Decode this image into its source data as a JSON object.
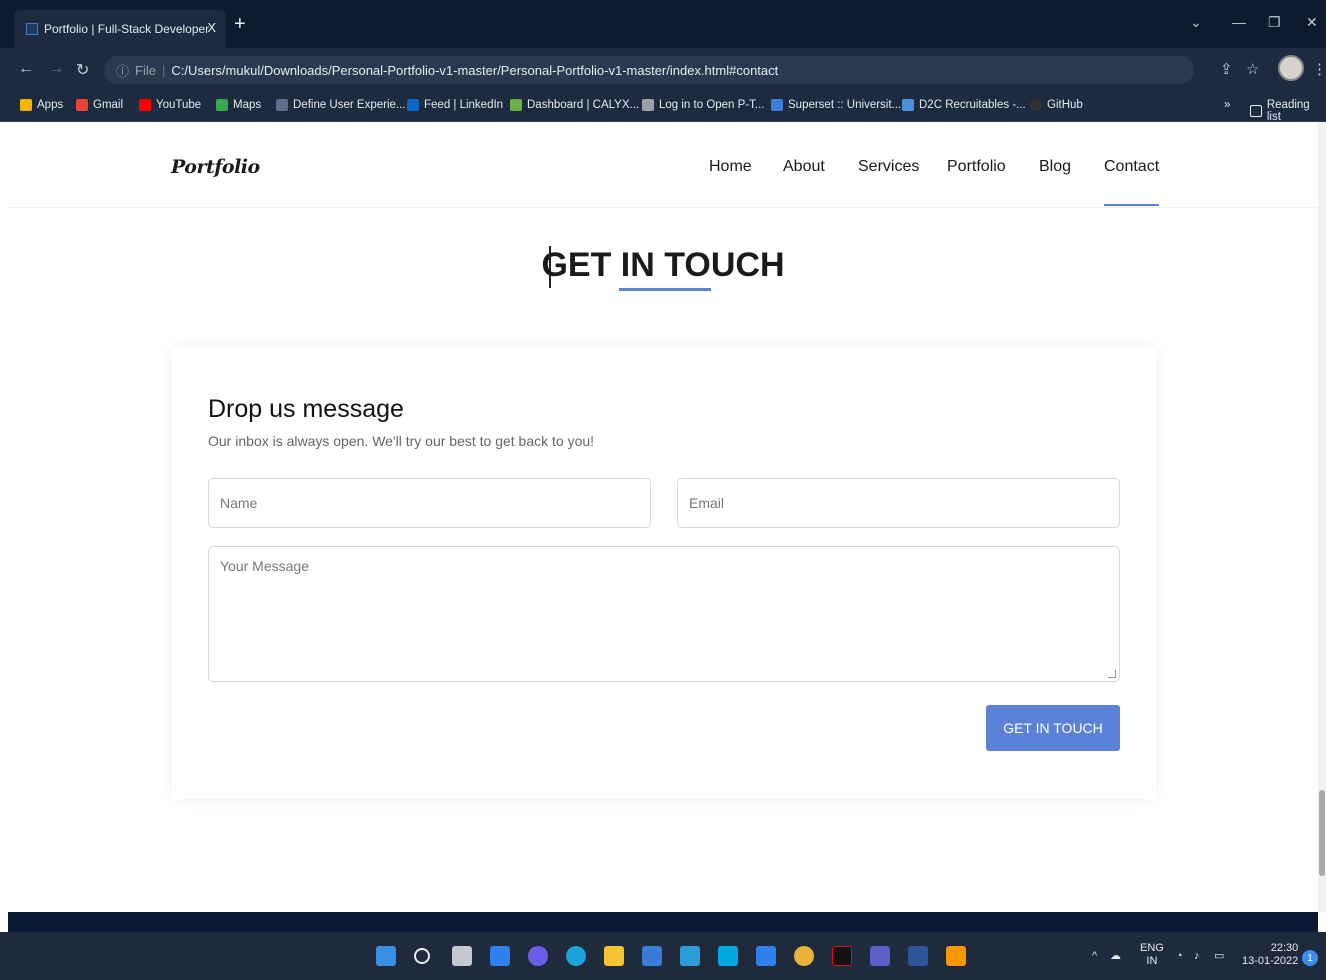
{
  "browser": {
    "tab_title": "Portfolio | Full-Stack Developer",
    "tab_close": "X",
    "new_tab": "+",
    "url_scheme": "File",
    "url": "C:/Users/mukul/Downloads/Personal-Portfolio-v1-master/Personal-Portfolio-v1-master/index.html#contact",
    "bookmarks": [
      {
        "label": "Apps",
        "color": "#f4b400"
      },
      {
        "label": "Gmail",
        "color": "#ea4335"
      },
      {
        "label": "YouTube",
        "color": "#ff0000"
      },
      {
        "label": "Maps",
        "color": "#34a853"
      },
      {
        "label": "Define User Experie...",
        "color": "#5b6f8c"
      },
      {
        "label": "Feed | LinkedIn",
        "color": "#0a66c2"
      },
      {
        "label": "Dashboard | CALYX...",
        "color": "#6ab04c"
      },
      {
        "label": "Log in to Open P-T...",
        "color": "#9aa0a6"
      },
      {
        "label": "Superset :: Universit...",
        "color": "#3c7fd8"
      },
      {
        "label": "D2C Recruitables -...",
        "color": "#4a90d9"
      },
      {
        "label": "GitHub",
        "color": "#333333"
      }
    ],
    "overflow": "»",
    "reading_list": "Reading list"
  },
  "site": {
    "logo": "Portfolio",
    "nav": [
      "Home",
      "About",
      "Services",
      "Portfolio",
      "Blog",
      "Contact"
    ],
    "active_nav": "Contact",
    "section_title": "GET IN TOUCH",
    "form": {
      "title": "Drop us message",
      "subtitle": "Our inbox is always open. We'll try our best to get back to you!",
      "name_placeholder": "Name",
      "email_placeholder": "Email",
      "message_placeholder": "Your Message",
      "submit_label": "GET IN TOUCH"
    },
    "accent_color": "#5b82d6"
  },
  "taskbar": {
    "lang_top": "ENG",
    "lang_bottom": "IN",
    "time": "22:30",
    "date": "13-01-2022",
    "notifications": "1"
  }
}
